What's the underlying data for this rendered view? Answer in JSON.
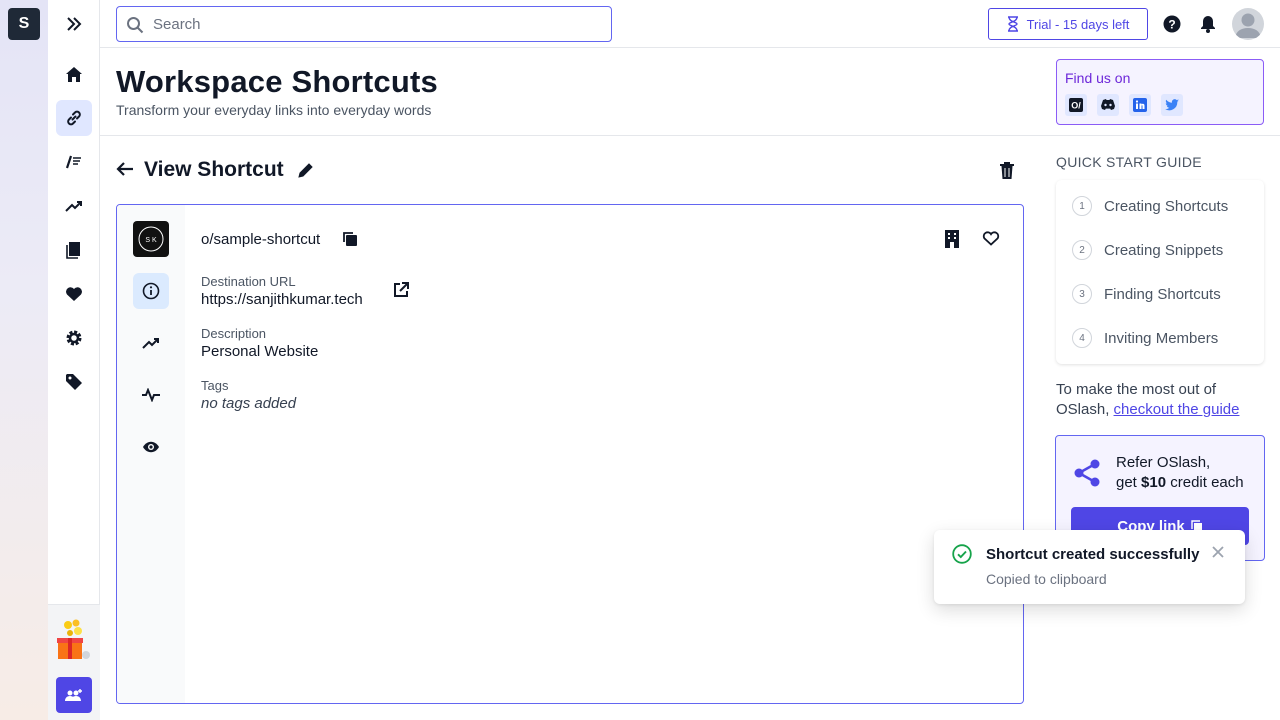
{
  "app": {
    "logo_letter": "S"
  },
  "search": {
    "placeholder": "Search"
  },
  "header": {
    "trial_label": "Trial - 15 days left"
  },
  "page": {
    "title": "Workspace Shortcuts",
    "subtitle": "Transform your everyday links into everyday words"
  },
  "find_us": {
    "label": "Find us on",
    "icons": [
      "oslash-icon",
      "discord-icon",
      "linkedin-icon",
      "twitter-icon"
    ]
  },
  "view": {
    "title": "View Shortcut"
  },
  "shortcut": {
    "logo_text": "S K",
    "name": "o/sample-shortcut",
    "destination_label": "Destination URL",
    "destination_value": "https://sanjithkumar.tech",
    "description_label": "Description",
    "description_value": "Personal Website",
    "tags_label": "Tags",
    "tags_value": "no tags added"
  },
  "quick_start": {
    "title": "QUICK START GUIDE",
    "items": [
      {
        "num": "1",
        "label": "Creating Shortcuts"
      },
      {
        "num": "2",
        "label": "Creating Snippets"
      },
      {
        "num": "3",
        "label": "Finding Shortcuts"
      },
      {
        "num": "4",
        "label": "Inviting Members"
      }
    ],
    "note_prefix": "To make the most out of OSlash,",
    "note_link": "checkout the guide"
  },
  "refer": {
    "line1": "Refer OSlash,",
    "line2_prefix": "get",
    "line2_bold": "$10",
    "line2_suffix": "credit each",
    "button": "Copy link"
  },
  "toast": {
    "title": "Shortcut created successfully",
    "message": "Copied to clipboard"
  },
  "colors": {
    "accent": "#4f46e5",
    "success": "#16a34a"
  }
}
